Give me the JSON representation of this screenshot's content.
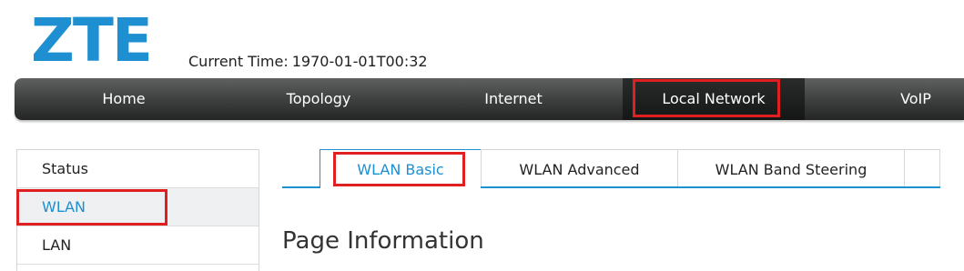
{
  "brand": {
    "logo_text": "ZTE",
    "logo_color": "#1e8fd0"
  },
  "header": {
    "time_label": "Current Time:",
    "time_value": "1970-01-01T00:32"
  },
  "nav": {
    "items": [
      {
        "label": "Home",
        "active": false
      },
      {
        "label": "Topology",
        "active": false
      },
      {
        "label": "Internet",
        "active": false
      },
      {
        "label": "Local Network",
        "active": true
      },
      {
        "label": "VoIP",
        "active": false
      }
    ]
  },
  "sidebar": {
    "items": [
      {
        "label": "Status",
        "active": false
      },
      {
        "label": "WLAN",
        "active": true
      },
      {
        "label": "LAN",
        "active": false
      }
    ]
  },
  "tabs": {
    "items": [
      {
        "label": "WLAN Basic",
        "active": true
      },
      {
        "label": "WLAN Advanced",
        "active": false
      },
      {
        "label": "WLAN Band Steering",
        "active": false
      }
    ]
  },
  "main": {
    "heading": "Page Information"
  },
  "colors": {
    "accent": "#1e8fd0",
    "highlight": "#e02020",
    "navbar": "#3f4141"
  }
}
